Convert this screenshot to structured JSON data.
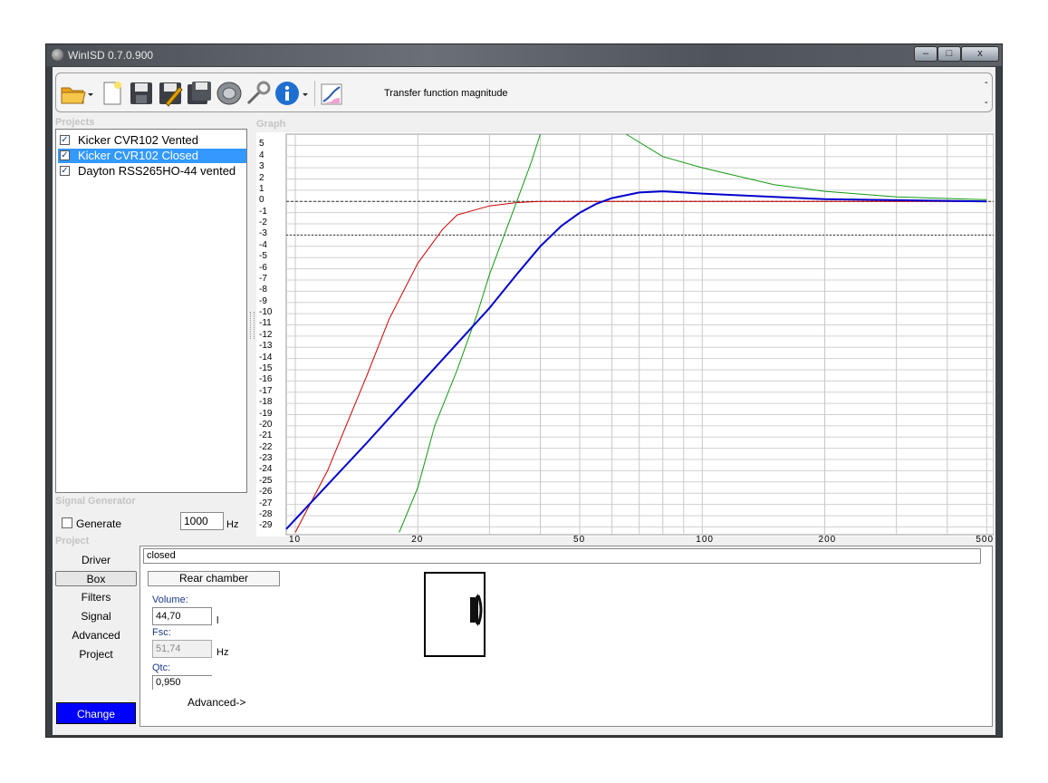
{
  "window": {
    "title": "WinISD 0.7.0.900"
  },
  "window_controls": {
    "minimize": "–",
    "maximize": "□",
    "close": "x"
  },
  "toolbar": {
    "graph_selector_label": "Transfer function magnitude",
    "scroll_up": "-",
    "scroll_down": "-"
  },
  "sections": {
    "projects": "Projects",
    "graph": "Graph",
    "signal_generator": "Signal Generator",
    "project": "Project"
  },
  "projects": [
    {
      "name": "Kicker CVR102 Vented",
      "checked": true,
      "selected": false
    },
    {
      "name": "Kicker CVR102 Closed",
      "checked": true,
      "selected": true
    },
    {
      "name": "Dayton RSS265HO-44 vented",
      "checked": true,
      "selected": false
    }
  ],
  "signal_generator": {
    "generate_label": "Generate",
    "frequency": "1000",
    "unit": "Hz"
  },
  "project_nav": [
    {
      "label": "Driver",
      "active": false
    },
    {
      "label": "Box",
      "active": true
    },
    {
      "label": "Filters",
      "active": false
    },
    {
      "label": "Signal",
      "active": false
    },
    {
      "label": "Advanced",
      "active": false
    },
    {
      "label": "Project",
      "active": false
    }
  ],
  "change_button": "Change",
  "box_panel": {
    "box_name": "closed",
    "rear_chamber_tab": "Rear chamber",
    "volume_label": "Volume:",
    "volume_value": "44,70",
    "volume_unit": "l",
    "fsc_label": "Fsc:",
    "fsc_value": "51,74",
    "fsc_unit": "Hz",
    "qtc_label": "Qtc:",
    "qtc_value": "0,950",
    "advanced_link": "Advanced->"
  },
  "colors": {
    "accent_selection": "#3399ff",
    "change_button": "#0000ff",
    "series_red": "#cc0000",
    "series_green": "#119911",
    "series_blue": "#0000cc"
  },
  "chart_data": {
    "type": "line",
    "title": "",
    "xlabel": "",
    "ylabel": "",
    "x_scale": "log",
    "xlim": [
      9.5,
      520
    ],
    "ylim": [
      -29.7,
      6
    ],
    "x_tick_labels": [
      "10",
      "20",
      "50",
      "100",
      "200",
      "500"
    ],
    "x_tick_values": [
      10,
      20,
      50,
      100,
      200,
      500
    ],
    "y_tick_values": [
      5,
      4,
      3,
      2,
      1,
      0,
      -1,
      -2,
      -3,
      -4,
      -5,
      -6,
      -7,
      -8,
      -9,
      -10,
      -11,
      -12,
      -13,
      -14,
      -15,
      -16,
      -17,
      -18,
      -19,
      -20,
      -21,
      -22,
      -23,
      -24,
      -25,
      -26,
      -27,
      -28,
      -29
    ],
    "reference_lines": [
      0,
      -3
    ],
    "grid": true,
    "series": [
      {
        "color": "#cc0000",
        "x": [
          10,
          12,
          15,
          17,
          20,
          23,
          25,
          30,
          35,
          40,
          50,
          60,
          100,
          200,
          500
        ],
        "y": [
          -29.5,
          -24,
          -15.5,
          -10.5,
          -5.5,
          -2.5,
          -1.2,
          -0.4,
          -0.1,
          0.0,
          0.0,
          0.0,
          0.0,
          0.0,
          0.0
        ]
      },
      {
        "color": "#119911",
        "x": [
          18,
          20,
          22,
          25,
          28,
          30,
          33,
          35,
          38,
          40
        ],
        "y": [
          -29.5,
          -25.5,
          -20,
          -15,
          -10,
          -6.5,
          -2.5,
          0.0,
          3.5,
          6.0
        ]
      },
      {
        "color": "#119911",
        "x": [
          65,
          80,
          100,
          150,
          200,
          300,
          500
        ],
        "y": [
          6.0,
          4.0,
          3.0,
          1.5,
          0.9,
          0.4,
          0.15
        ]
      },
      {
        "color": "#0000cc",
        "x": [
          9.5,
          15,
          20,
          30,
          35,
          40,
          45,
          50,
          55,
          60,
          70,
          80,
          90,
          100,
          150,
          200,
          500
        ],
        "y": [
          -29.2,
          -21.5,
          -16.5,
          -9.5,
          -6.5,
          -4.0,
          -2.2,
          -1.0,
          -0.2,
          0.3,
          0.8,
          0.9,
          0.8,
          0.7,
          0.4,
          0.2,
          0.0
        ]
      }
    ]
  }
}
